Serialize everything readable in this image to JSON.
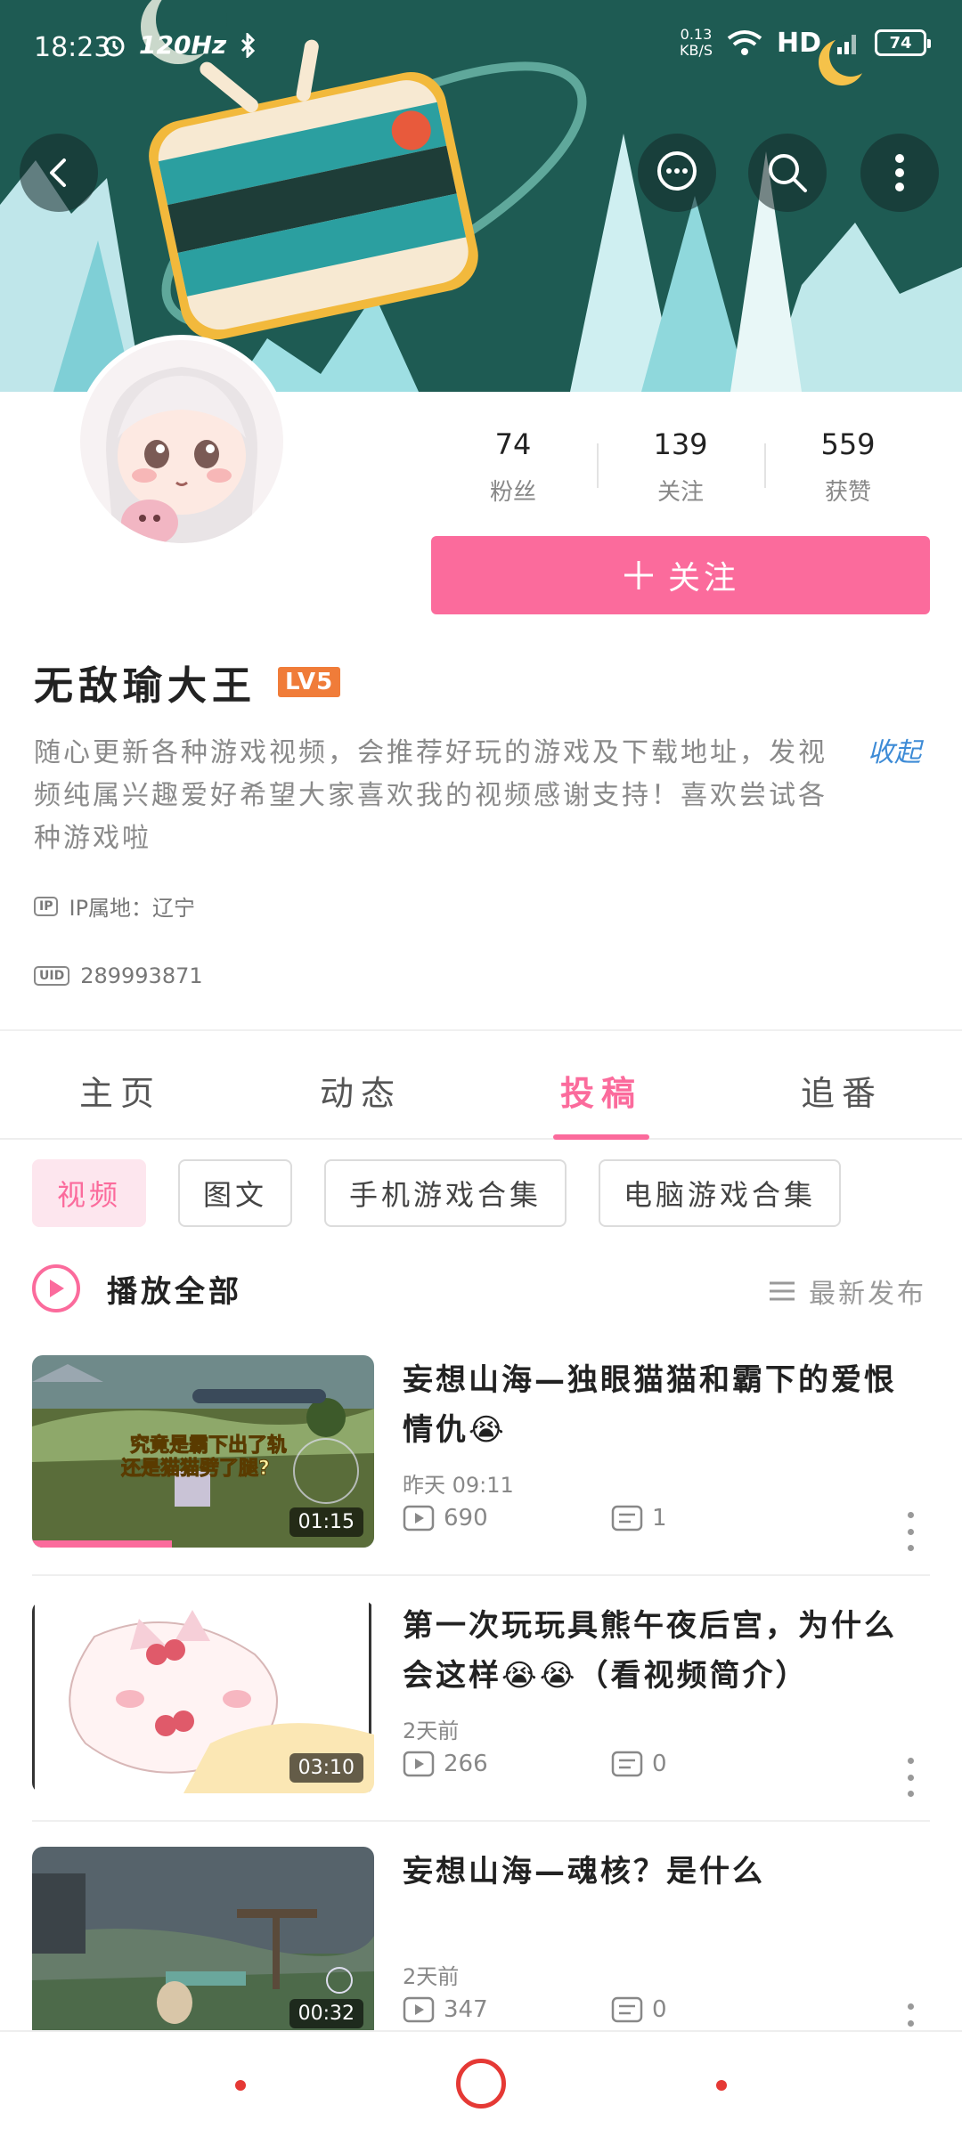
{
  "status_bar": {
    "time": "18:23",
    "refresh_rate": "120Hz",
    "net_speed_value": "0.13",
    "net_speed_unit": "KB/S",
    "network_label": "HD",
    "battery": "74"
  },
  "header": {
    "back_icon": "chevron-left-icon",
    "message_icon": "chat-bubble-icon",
    "search_icon": "search-icon",
    "more_icon": "more-vertical-icon"
  },
  "profile": {
    "stats": [
      {
        "value": "74",
        "label": "粉丝"
      },
      {
        "value": "139",
        "label": "关注"
      },
      {
        "value": "559",
        "label": "获赞"
      }
    ],
    "follow_label": "关注",
    "username": "无敌瑜大王",
    "level": "LV5",
    "bio": "随心更新各种游戏视频，会推荐好玩的游戏及下载地址，发视频纯属兴趣爱好希望大家喜欢我的视频感谢支持！喜欢尝试各种游戏啦",
    "collapse_label": "收起",
    "ip_tag": "IP",
    "ip_text": "IP属地：辽宁",
    "uid_tag": "UID",
    "uid": "289993871"
  },
  "tabs": [
    {
      "label": "主页"
    },
    {
      "label": "动态"
    },
    {
      "label": "投稿",
      "active": true
    },
    {
      "label": "追番"
    }
  ],
  "chips": [
    {
      "label": "视频",
      "active": true
    },
    {
      "label": "图文"
    },
    {
      "label": "手机游戏合集"
    },
    {
      "label": "电脑游戏合集"
    }
  ],
  "play_all_label": "播放全部",
  "sort_label": "最新发布",
  "videos": [
    {
      "title": "妄想山海—独眼猫猫和霸下的爱恨情仇😭",
      "date": "昨天  09:11",
      "duration": "01:15",
      "views": "690",
      "comments": "1",
      "overlay_text_1": "究竟是霸下出了轨",
      "overlay_text_2": "还是猫猫劈了腿?",
      "watch_progress": 0.41
    },
    {
      "title": "第一次玩玩具熊午夜后宫，为什么会这样😭😭（看视频简介）",
      "date": "2天前",
      "duration": "03:10",
      "views": "266",
      "comments": "0"
    },
    {
      "title": "妄想山海—魂核？是什么",
      "date": "2天前",
      "duration": "00:32",
      "views": "347",
      "comments": "0"
    }
  ],
  "colors": {
    "accent": "#fb6b9c",
    "banner": "#1d5a52",
    "level_badge": "#f07c39",
    "link": "#3d8bd6"
  }
}
